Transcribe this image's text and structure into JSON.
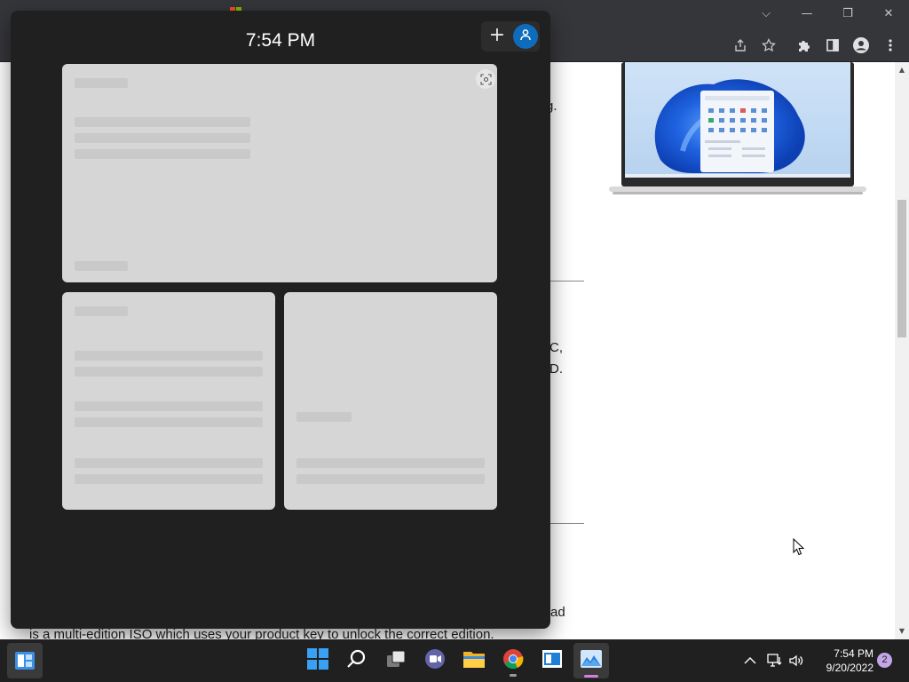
{
  "widgets_panel": {
    "time": "7:54 PM",
    "add_label": "+"
  },
  "page_fragments": {
    "frag_1": "g.",
    "frag_2": "C,",
    "frag_3": "D.",
    "frag_4": "ad",
    "bottom_line": "is a multi-edition ISO which uses your product key to unlock the correct edition."
  },
  "taskbar": {
    "apps": [
      {
        "name": "start",
        "icon": "windows-logo-icon"
      },
      {
        "name": "search",
        "icon": "search-icon"
      },
      {
        "name": "task-view",
        "icon": "task-view-icon"
      },
      {
        "name": "teams-chat",
        "icon": "chat-icon"
      },
      {
        "name": "file-explorer",
        "icon": "folder-icon"
      },
      {
        "name": "chrome",
        "icon": "chrome-icon"
      },
      {
        "name": "windows-app",
        "icon": "app-window-icon"
      },
      {
        "name": "photos",
        "icon": "photos-icon"
      }
    ],
    "clock_time": "7:54 PM",
    "clock_date": "9/20/2022",
    "notification_count": "2"
  },
  "colors": {
    "accent": "#0f6cbd",
    "panel_bg": "#202020",
    "card_bg": "#d6d6d6",
    "active_indicator": "#d47fdc",
    "badge": "#c3a6e8"
  }
}
